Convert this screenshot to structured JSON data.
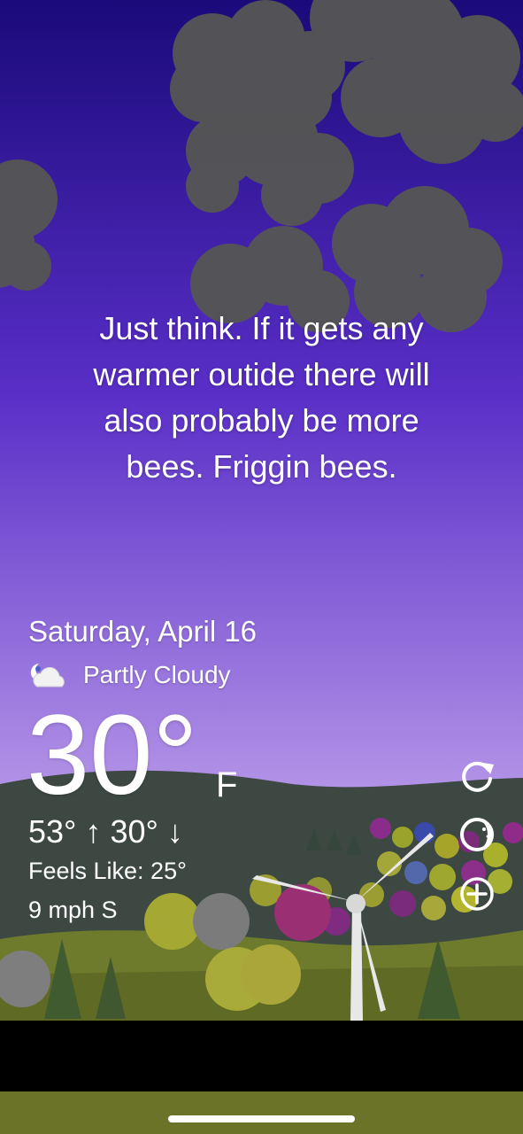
{
  "message": {
    "line1": "Just think. If it gets any",
    "line2": "warmer outide there will",
    "line3": "also probably be more",
    "line4": "bees. Friggin bees."
  },
  "weather": {
    "date": "Saturday, April 16",
    "condition_icon": "partly-cloudy-night-icon",
    "condition": "Partly Cloudy",
    "temperature": "30°",
    "unit": "F",
    "hi_lo": "53° ↑ 30° ↓",
    "feels_like": "Feels Like: 25°",
    "wind": "9 mph S"
  },
  "actions": {
    "refresh_icon": "refresh-icon",
    "theme_icon": "theme-icon",
    "add_icon": "add-location-icon"
  },
  "colors": {
    "sky_top": "#1a0a7a",
    "sky_bottom": "#c9b0f2",
    "hills": "#3b4640",
    "grass": "#6f7a2a"
  }
}
